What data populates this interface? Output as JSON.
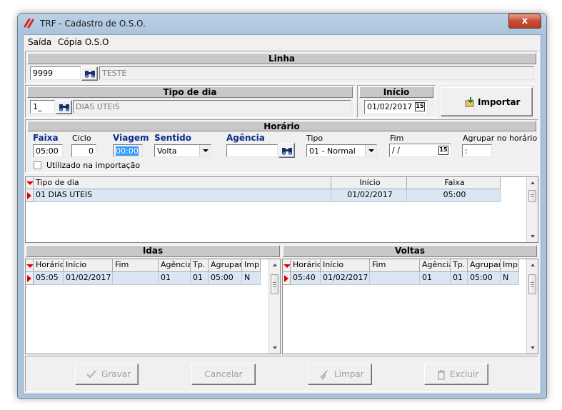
{
  "window": {
    "title": "TRF - Cadastro de O.S.O.",
    "close_label": "x",
    "colors": {
      "frame": "#a9c3dc",
      "close": "#c74d33",
      "selected_row": "#dae6f3",
      "indicator": "#e00000"
    }
  },
  "menu": [
    "Saída",
    "Cópia O.S.O"
  ],
  "linha": {
    "header": "Linha",
    "code": "9999",
    "name": "TESTE",
    "lookup_icon": "binoculars-icon"
  },
  "tipo_dia": {
    "header": "Tipo de dia",
    "code": "1_",
    "name": "DIAS UTEIS"
  },
  "inicio": {
    "header": "Início",
    "date": "01/02/2017",
    "cal_label": "15"
  },
  "importar": {
    "label": "Importar",
    "icon": "import-icon"
  },
  "horario": {
    "header": "Horário",
    "faixa_label": "Faixa",
    "faixa": "05:00",
    "ciclo_label": "Ciclo",
    "ciclo": "0",
    "viagem_label": "Viagem",
    "viagem": "00:00",
    "sentido_label": "Sentido",
    "sentido": "Volta",
    "agencia_label": "Agência",
    "agencia": "",
    "tipo_label": "Tipo",
    "tipo": "01 - Normal",
    "fim_label": "Fim",
    "fim": " / /",
    "agrupar_label": "Agrupar no horário",
    "agrupar": " :",
    "checkbox_label": "Utilizado na importação",
    "checkbox_checked": false
  },
  "grid_tipo": {
    "columns": [
      "Tipo de dia",
      "Início",
      "Faixa"
    ],
    "rows": [
      [
        "01 DIAS UTEIS",
        "01/02/2017",
        "05:00"
      ]
    ]
  },
  "idas": {
    "header": "Idas",
    "columns": [
      "Horário",
      "Início",
      "Fim",
      "Agência",
      "Tp.",
      "Agrupar",
      "Imp."
    ],
    "rows": [
      [
        "05:05",
        "01/02/2017",
        "",
        "01",
        "01",
        "05:00",
        "N"
      ]
    ]
  },
  "voltas": {
    "header": "Voltas",
    "columns": [
      "Horário",
      "Início",
      "Fim",
      "Agência",
      "Tp.",
      "Agrupar",
      "Imp."
    ],
    "rows": [
      [
        "05:40",
        "01/02/2017",
        "",
        "01",
        "01",
        "05:00",
        "N"
      ]
    ]
  },
  "buttons": {
    "gravar": "Gravar",
    "cancelar": "Cancelar",
    "limpar": "Limpar",
    "excluir": "Excluir"
  }
}
